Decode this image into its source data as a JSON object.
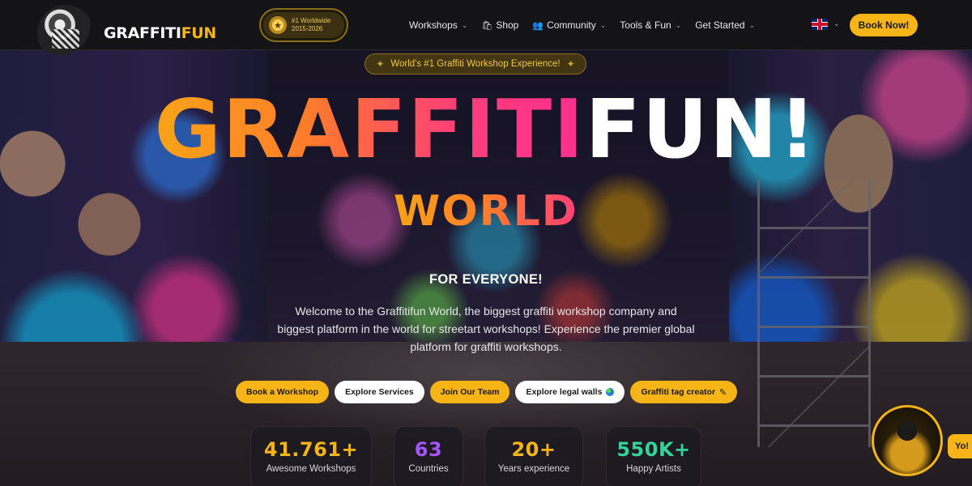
{
  "header": {
    "logo_text_white": "GRAFFITI",
    "logo_text_yellow": "FUN",
    "award_line1": "#1 Worldwide",
    "award_line2": "2015-2026",
    "nav": [
      {
        "label": "Workshops",
        "icon": "",
        "has_dropdown": true
      },
      {
        "label": "Shop",
        "icon": "bag-icon",
        "has_dropdown": false
      },
      {
        "label": "Community",
        "icon": "users-icon",
        "has_dropdown": true
      },
      {
        "label": "Tools & Fun",
        "icon": "",
        "has_dropdown": true
      },
      {
        "label": "Get Started",
        "icon": "",
        "has_dropdown": true
      }
    ],
    "language": "uk-flag-icon",
    "book_now": "Book Now!"
  },
  "hero": {
    "badge": "World's #1 Graffiti Workshop Experience!",
    "title_part1": "GRAFFITI",
    "title_part2": "FUN!",
    "subtitle": "WORLD",
    "tagline": "FOR EVERYONE!",
    "description": "Welcome to the Graffitifun World, the biggest graffiti workshop company and biggest platform in the world for streetart workshops! Experience the premier global platform for graffiti workshops.",
    "buttons": [
      {
        "label": "Book a Workshop",
        "style": "yellow"
      },
      {
        "label": "Explore Services",
        "style": "white"
      },
      {
        "label": "Join Our Team",
        "style": "yellow"
      },
      {
        "label": "Explore legal walls",
        "style": "white",
        "icon": "globe-icon"
      },
      {
        "label": "Graffiti tag creator",
        "style": "yellow",
        "icon": "pencil-icon"
      }
    ],
    "stats": [
      {
        "value": "41.761+",
        "label": "Awesome Workshops",
        "color": "#f6b417"
      },
      {
        "value": "63",
        "label": "Countries",
        "color": "#a855f7"
      },
      {
        "value": "20+",
        "label": "Years experience",
        "color": "#f6b417"
      },
      {
        "value": "550K+",
        "label": "Happy Artists",
        "color": "#34d399"
      }
    ]
  },
  "chat": {
    "bubble": "Yo!"
  },
  "colors": {
    "accent": "#f6b417",
    "header_bg": "#141416"
  }
}
